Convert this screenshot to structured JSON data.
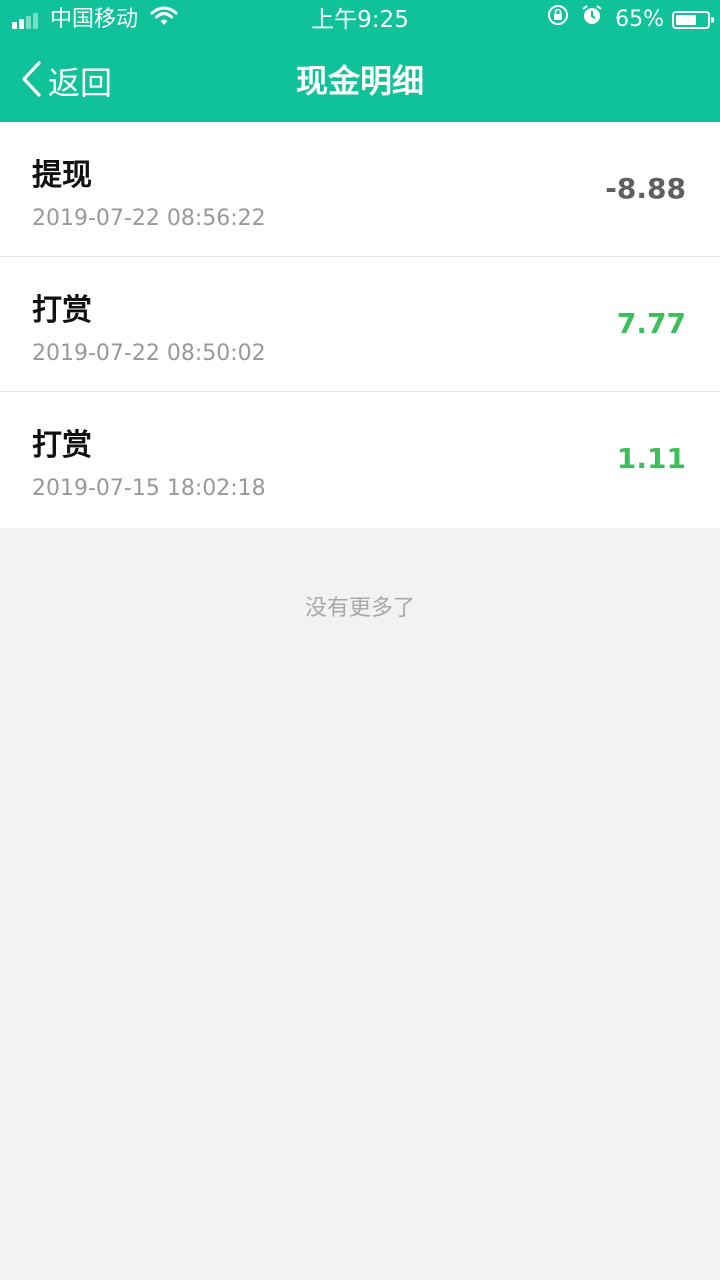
{
  "status_bar": {
    "carrier": "中国移动",
    "time": "上午9:25",
    "battery_text": "65%",
    "battery_level": 0.65
  },
  "nav": {
    "back_label": "返回",
    "title": "现金明细"
  },
  "records": [
    {
      "title": "提现",
      "time": "2019-07-22 08:56:22",
      "amount": "-8.88",
      "color": "#5f5f5f"
    },
    {
      "title": "打赏",
      "time": "2019-07-22 08:50:02",
      "amount": "7.77",
      "color": "#3cbf5a"
    },
    {
      "title": "打赏",
      "time": "2019-07-15 18:02:18",
      "amount": "1.11",
      "color": "#3cbf5a"
    }
  ],
  "footer": {
    "no_more": "没有更多了"
  },
  "colors": {
    "header": "#10c29a",
    "background": "#f2f2f2"
  }
}
